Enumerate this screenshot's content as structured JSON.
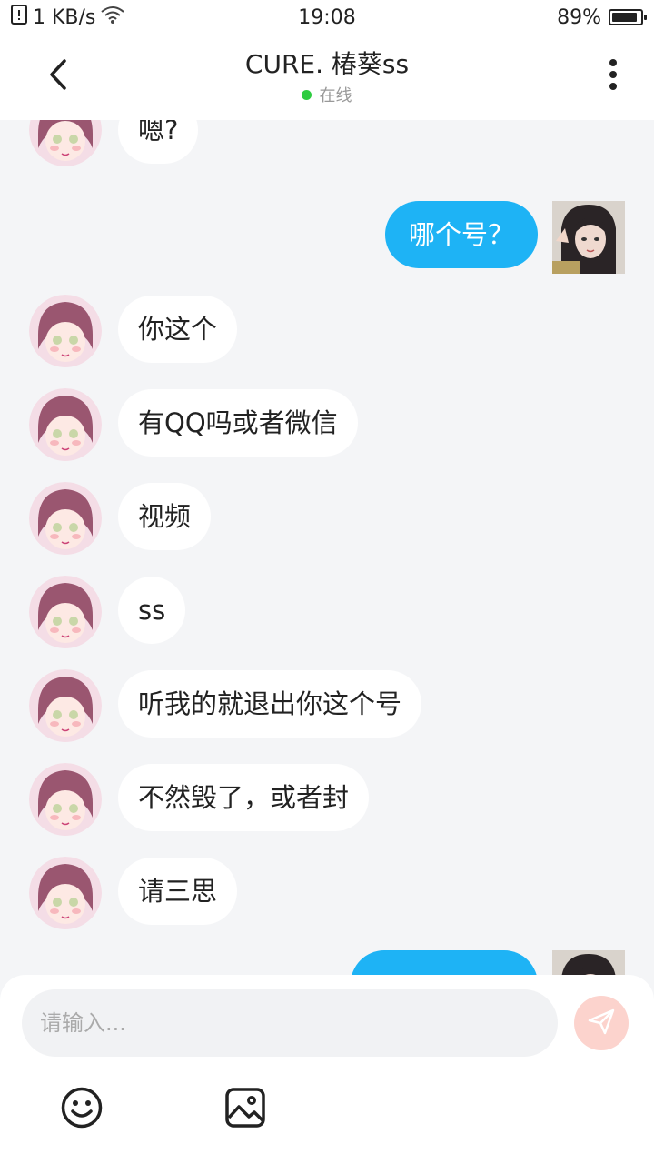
{
  "status_bar": {
    "network_speed": "1 KB/s",
    "time": "19:08",
    "battery": "89%",
    "battery_level": 0.89
  },
  "header": {
    "title": "CURE. 椿葵ss",
    "presence": "在线",
    "presence_color": "#2ecc40"
  },
  "messages": [
    {
      "side": "in",
      "text": "嗯?"
    },
    {
      "side": "out",
      "text": "哪个号？"
    },
    {
      "side": "in",
      "text": "你这个"
    },
    {
      "side": "in",
      "text": "有QQ吗或者微信"
    },
    {
      "side": "in",
      "text": "视频"
    },
    {
      "side": "in",
      "text": "ss"
    },
    {
      "side": "in",
      "text": "听我的就退出你这个号"
    },
    {
      "side": "in",
      "text": "不然毁了，或者封"
    },
    {
      "side": "in",
      "text": "请三思"
    },
    {
      "side": "out",
      "text": ""
    }
  ],
  "composer": {
    "placeholder": "请输入..."
  },
  "colors": {
    "outgoing_bubble": "#1eb3f5",
    "incoming_bubble": "#ffffff",
    "send_button": "#fcd3cd"
  },
  "icons": {
    "back": "chevron-left-icon",
    "more": "more-vertical-icon",
    "send": "send-icon",
    "emoji": "emoji-icon",
    "image": "image-icon"
  }
}
